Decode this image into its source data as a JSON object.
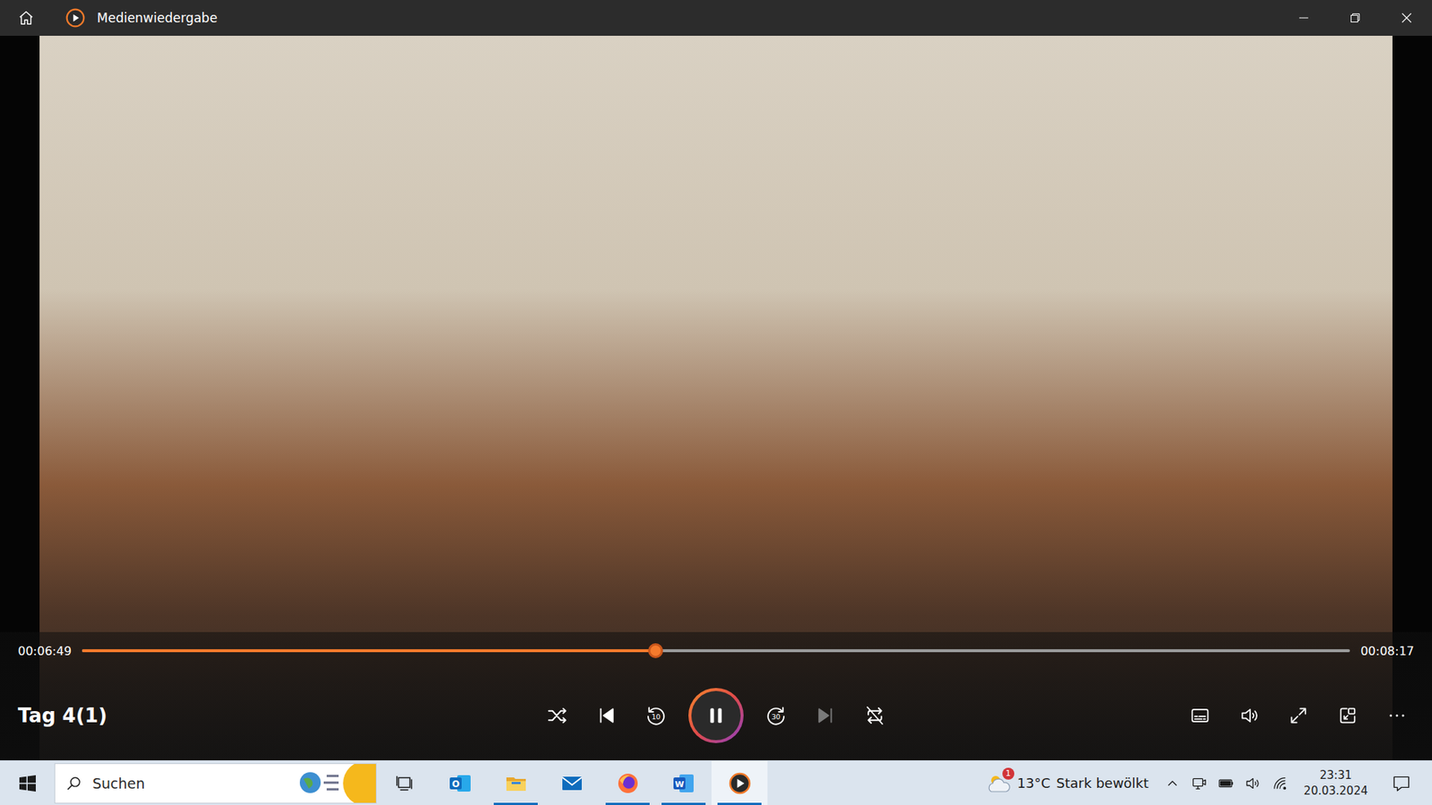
{
  "window": {
    "title": "Medienwiedergabe"
  },
  "player": {
    "title": "Tag 4(1)",
    "progress": {
      "elapsed": "00:06:49",
      "total": "00:08:17",
      "level": 0.4525
    },
    "controls": [
      {
        "kind": "shuffle",
        "label": "",
        "on": false,
        "disabled": false
      },
      {
        "kind": "previous",
        "label": "",
        "on": false,
        "disabled": false
      },
      {
        "kind": "rewind",
        "label": "10",
        "on": false,
        "disabled": false
      },
      {
        "kind": "play-pause",
        "label": "",
        "on": true,
        "disabled": false
      },
      {
        "kind": "forward",
        "label": "30",
        "on": false,
        "disabled": false
      },
      {
        "kind": "next",
        "label": "",
        "on": false,
        "disabled": true
      },
      {
        "kind": "repeat",
        "label": "",
        "on": false,
        "disabled": false
      }
    ],
    "tools": [
      {
        "kind": "subtitles"
      },
      {
        "kind": "volume"
      },
      {
        "kind": "fullscreen"
      },
      {
        "kind": "miniplayer"
      },
      {
        "kind": "more"
      }
    ]
  },
  "taskbar": {
    "search": {
      "placeholder": "Suchen"
    },
    "apps": [
      {
        "kind": "outlook",
        "glyph": "O",
        "active": false,
        "selected": false
      },
      {
        "kind": "explorer",
        "glyph": "",
        "active": true,
        "selected": false
      },
      {
        "kind": "mail",
        "glyph": "",
        "active": false,
        "selected": false
      },
      {
        "kind": "firefox",
        "glyph": "",
        "active": true,
        "selected": false
      },
      {
        "kind": "word",
        "glyph": "W",
        "active": true,
        "selected": false
      },
      {
        "kind": "player",
        "glyph": "",
        "active": true,
        "selected": true
      }
    ],
    "weather": {
      "temperature": "13°C",
      "condition": "Stark bewölkt",
      "badge": "1"
    },
    "tray": [
      {
        "kind": "chevron"
      },
      {
        "kind": "meet"
      },
      {
        "kind": "battery"
      },
      {
        "kind": "volume"
      },
      {
        "kind": "wifi"
      }
    ],
    "clock": {
      "time": "23:31",
      "date": "20.03.2024"
    }
  }
}
